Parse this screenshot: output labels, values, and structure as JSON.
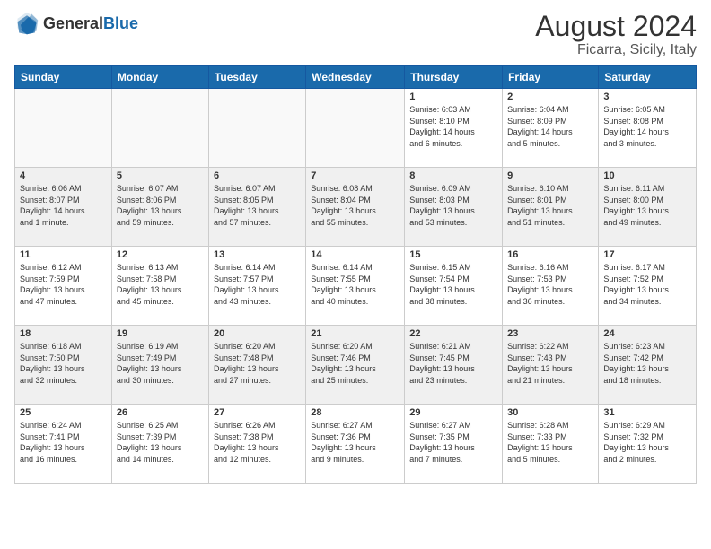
{
  "header": {
    "logo_general": "General",
    "logo_blue": "Blue",
    "month_year": "August 2024",
    "location": "Ficarra, Sicily, Italy"
  },
  "weekdays": [
    "Sunday",
    "Monday",
    "Tuesday",
    "Wednesday",
    "Thursday",
    "Friday",
    "Saturday"
  ],
  "weeks": [
    [
      {
        "day": "",
        "info": ""
      },
      {
        "day": "",
        "info": ""
      },
      {
        "day": "",
        "info": ""
      },
      {
        "day": "",
        "info": ""
      },
      {
        "day": "1",
        "info": "Sunrise: 6:03 AM\nSunset: 8:10 PM\nDaylight: 14 hours\nand 6 minutes."
      },
      {
        "day": "2",
        "info": "Sunrise: 6:04 AM\nSunset: 8:09 PM\nDaylight: 14 hours\nand 5 minutes."
      },
      {
        "day": "3",
        "info": "Sunrise: 6:05 AM\nSunset: 8:08 PM\nDaylight: 14 hours\nand 3 minutes."
      }
    ],
    [
      {
        "day": "4",
        "info": "Sunrise: 6:06 AM\nSunset: 8:07 PM\nDaylight: 14 hours\nand 1 minute."
      },
      {
        "day": "5",
        "info": "Sunrise: 6:07 AM\nSunset: 8:06 PM\nDaylight: 13 hours\nand 59 minutes."
      },
      {
        "day": "6",
        "info": "Sunrise: 6:07 AM\nSunset: 8:05 PM\nDaylight: 13 hours\nand 57 minutes."
      },
      {
        "day": "7",
        "info": "Sunrise: 6:08 AM\nSunset: 8:04 PM\nDaylight: 13 hours\nand 55 minutes."
      },
      {
        "day": "8",
        "info": "Sunrise: 6:09 AM\nSunset: 8:03 PM\nDaylight: 13 hours\nand 53 minutes."
      },
      {
        "day": "9",
        "info": "Sunrise: 6:10 AM\nSunset: 8:01 PM\nDaylight: 13 hours\nand 51 minutes."
      },
      {
        "day": "10",
        "info": "Sunrise: 6:11 AM\nSunset: 8:00 PM\nDaylight: 13 hours\nand 49 minutes."
      }
    ],
    [
      {
        "day": "11",
        "info": "Sunrise: 6:12 AM\nSunset: 7:59 PM\nDaylight: 13 hours\nand 47 minutes."
      },
      {
        "day": "12",
        "info": "Sunrise: 6:13 AM\nSunset: 7:58 PM\nDaylight: 13 hours\nand 45 minutes."
      },
      {
        "day": "13",
        "info": "Sunrise: 6:14 AM\nSunset: 7:57 PM\nDaylight: 13 hours\nand 43 minutes."
      },
      {
        "day": "14",
        "info": "Sunrise: 6:14 AM\nSunset: 7:55 PM\nDaylight: 13 hours\nand 40 minutes."
      },
      {
        "day": "15",
        "info": "Sunrise: 6:15 AM\nSunset: 7:54 PM\nDaylight: 13 hours\nand 38 minutes."
      },
      {
        "day": "16",
        "info": "Sunrise: 6:16 AM\nSunset: 7:53 PM\nDaylight: 13 hours\nand 36 minutes."
      },
      {
        "day": "17",
        "info": "Sunrise: 6:17 AM\nSunset: 7:52 PM\nDaylight: 13 hours\nand 34 minutes."
      }
    ],
    [
      {
        "day": "18",
        "info": "Sunrise: 6:18 AM\nSunset: 7:50 PM\nDaylight: 13 hours\nand 32 minutes."
      },
      {
        "day": "19",
        "info": "Sunrise: 6:19 AM\nSunset: 7:49 PM\nDaylight: 13 hours\nand 30 minutes."
      },
      {
        "day": "20",
        "info": "Sunrise: 6:20 AM\nSunset: 7:48 PM\nDaylight: 13 hours\nand 27 minutes."
      },
      {
        "day": "21",
        "info": "Sunrise: 6:20 AM\nSunset: 7:46 PM\nDaylight: 13 hours\nand 25 minutes."
      },
      {
        "day": "22",
        "info": "Sunrise: 6:21 AM\nSunset: 7:45 PM\nDaylight: 13 hours\nand 23 minutes."
      },
      {
        "day": "23",
        "info": "Sunrise: 6:22 AM\nSunset: 7:43 PM\nDaylight: 13 hours\nand 21 minutes."
      },
      {
        "day": "24",
        "info": "Sunrise: 6:23 AM\nSunset: 7:42 PM\nDaylight: 13 hours\nand 18 minutes."
      }
    ],
    [
      {
        "day": "25",
        "info": "Sunrise: 6:24 AM\nSunset: 7:41 PM\nDaylight: 13 hours\nand 16 minutes."
      },
      {
        "day": "26",
        "info": "Sunrise: 6:25 AM\nSunset: 7:39 PM\nDaylight: 13 hours\nand 14 minutes."
      },
      {
        "day": "27",
        "info": "Sunrise: 6:26 AM\nSunset: 7:38 PM\nDaylight: 13 hours\nand 12 minutes."
      },
      {
        "day": "28",
        "info": "Sunrise: 6:27 AM\nSunset: 7:36 PM\nDaylight: 13 hours\nand 9 minutes."
      },
      {
        "day": "29",
        "info": "Sunrise: 6:27 AM\nSunset: 7:35 PM\nDaylight: 13 hours\nand 7 minutes."
      },
      {
        "day": "30",
        "info": "Sunrise: 6:28 AM\nSunset: 7:33 PM\nDaylight: 13 hours\nand 5 minutes."
      },
      {
        "day": "31",
        "info": "Sunrise: 6:29 AM\nSunset: 7:32 PM\nDaylight: 13 hours\nand 2 minutes."
      }
    ]
  ]
}
